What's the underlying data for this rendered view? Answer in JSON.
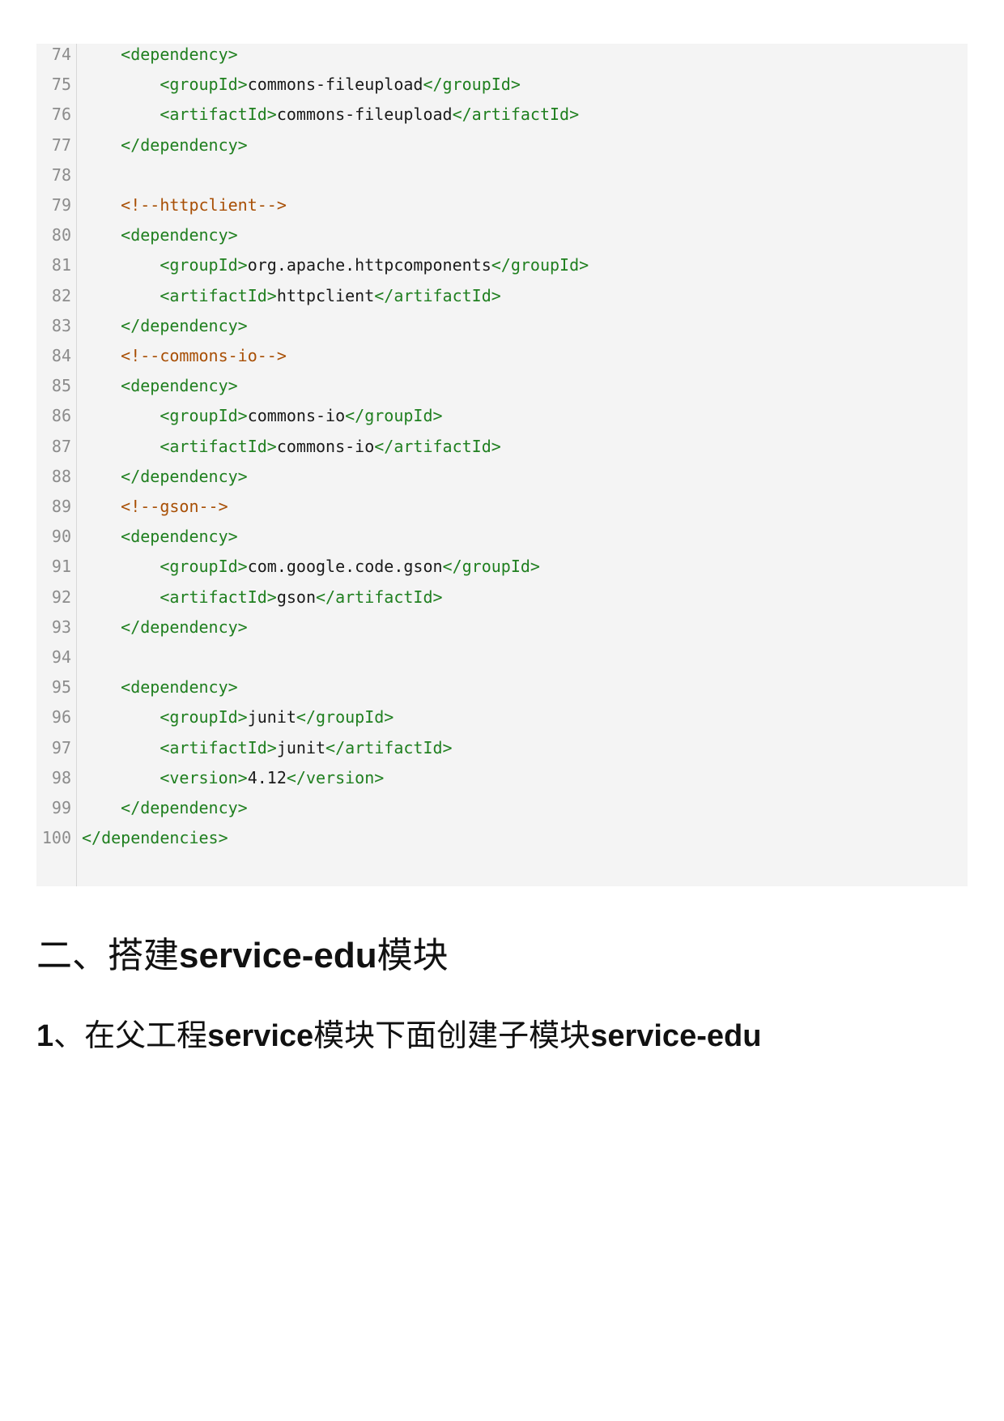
{
  "code": {
    "lines": [
      {
        "number": "74",
        "indent": "    ",
        "parts": [
          {
            "type": "tag",
            "text": "<dependency>"
          }
        ]
      },
      {
        "number": "75",
        "indent": "        ",
        "parts": [
          {
            "type": "tag",
            "text": "<groupId>"
          },
          {
            "type": "text",
            "text": "commons-fileupload"
          },
          {
            "type": "tag",
            "text": "</groupId>"
          }
        ]
      },
      {
        "number": "76",
        "indent": "        ",
        "parts": [
          {
            "type": "tag",
            "text": "<artifactId>"
          },
          {
            "type": "text",
            "text": "commons-fileupload"
          },
          {
            "type": "tag",
            "text": "</artifactId>"
          }
        ]
      },
      {
        "number": "77",
        "indent": "    ",
        "parts": [
          {
            "type": "tag",
            "text": "</dependency>"
          }
        ]
      },
      {
        "number": "78",
        "indent": "",
        "parts": []
      },
      {
        "number": "79",
        "indent": "    ",
        "parts": [
          {
            "type": "comment",
            "text": "<!--httpclient-->"
          }
        ]
      },
      {
        "number": "80",
        "indent": "    ",
        "parts": [
          {
            "type": "tag",
            "text": "<dependency>"
          }
        ]
      },
      {
        "number": "81",
        "indent": "        ",
        "parts": [
          {
            "type": "tag",
            "text": "<groupId>"
          },
          {
            "type": "text",
            "text": "org.apache.httpcomponents"
          },
          {
            "type": "tag",
            "text": "</groupId>"
          }
        ]
      },
      {
        "number": "82",
        "indent": "        ",
        "parts": [
          {
            "type": "tag",
            "text": "<artifactId>"
          },
          {
            "type": "text",
            "text": "httpclient"
          },
          {
            "type": "tag",
            "text": "</artifactId>"
          }
        ]
      },
      {
        "number": "83",
        "indent": "    ",
        "parts": [
          {
            "type": "tag",
            "text": "</dependency>"
          }
        ]
      },
      {
        "number": "84",
        "indent": "    ",
        "parts": [
          {
            "type": "comment",
            "text": "<!--commons-io-->"
          }
        ]
      },
      {
        "number": "85",
        "indent": "    ",
        "parts": [
          {
            "type": "tag",
            "text": "<dependency>"
          }
        ]
      },
      {
        "number": "86",
        "indent": "        ",
        "parts": [
          {
            "type": "tag",
            "text": "<groupId>"
          },
          {
            "type": "text",
            "text": "commons-io"
          },
          {
            "type": "tag",
            "text": "</groupId>"
          }
        ]
      },
      {
        "number": "87",
        "indent": "        ",
        "parts": [
          {
            "type": "tag",
            "text": "<artifactId>"
          },
          {
            "type": "text",
            "text": "commons-io"
          },
          {
            "type": "tag",
            "text": "</artifactId>"
          }
        ]
      },
      {
        "number": "88",
        "indent": "    ",
        "parts": [
          {
            "type": "tag",
            "text": "</dependency>"
          }
        ]
      },
      {
        "number": "89",
        "indent": "    ",
        "parts": [
          {
            "type": "comment",
            "text": "<!--gson-->"
          }
        ]
      },
      {
        "number": "90",
        "indent": "    ",
        "parts": [
          {
            "type": "tag",
            "text": "<dependency>"
          }
        ]
      },
      {
        "number": "91",
        "indent": "        ",
        "parts": [
          {
            "type": "tag",
            "text": "<groupId>"
          },
          {
            "type": "text",
            "text": "com.google.code.gson"
          },
          {
            "type": "tag",
            "text": "</groupId>"
          }
        ]
      },
      {
        "number": "92",
        "indent": "        ",
        "parts": [
          {
            "type": "tag",
            "text": "<artifactId>"
          },
          {
            "type": "text",
            "text": "gson"
          },
          {
            "type": "tag",
            "text": "</artifactId>"
          }
        ]
      },
      {
        "number": "93",
        "indent": "    ",
        "parts": [
          {
            "type": "tag",
            "text": "</dependency>"
          }
        ]
      },
      {
        "number": "94",
        "indent": "",
        "parts": []
      },
      {
        "number": "95",
        "indent": "    ",
        "parts": [
          {
            "type": "tag",
            "text": "<dependency>"
          }
        ]
      },
      {
        "number": "96",
        "indent": "        ",
        "parts": [
          {
            "type": "tag",
            "text": "<groupId>"
          },
          {
            "type": "text",
            "text": "junit"
          },
          {
            "type": "tag",
            "text": "</groupId>"
          }
        ]
      },
      {
        "number": "97",
        "indent": "        ",
        "parts": [
          {
            "type": "tag",
            "text": "<artifactId>"
          },
          {
            "type": "text",
            "text": "junit"
          },
          {
            "type": "tag",
            "text": "</artifactId>"
          }
        ]
      },
      {
        "number": "98",
        "indent": "        ",
        "parts": [
          {
            "type": "tag",
            "text": "<version>"
          },
          {
            "type": "text",
            "text": "4.12"
          },
          {
            "type": "tag",
            "text": "</version>"
          }
        ]
      },
      {
        "number": "99",
        "indent": "    ",
        "parts": [
          {
            "type": "tag",
            "text": "</dependency>"
          }
        ]
      },
      {
        "number": "100",
        "indent": "",
        "parts": [
          {
            "type": "tag",
            "text": "</dependencies>"
          }
        ]
      }
    ]
  },
  "section": {
    "prefix": "二、搭建",
    "bold": "service-edu",
    "suffix": "模块"
  },
  "subsection": {
    "number": "1",
    "text1": "、在父工程",
    "bold1": "service",
    "text2": "模块下面创建子模块",
    "bold2": "service-edu"
  },
  "colors": {
    "tag": "#1f7f1f",
    "text": "#1a1a1a",
    "comment": "#a84f05",
    "line_number": "#8c8c8c",
    "code_background": "#f4f4f4"
  }
}
